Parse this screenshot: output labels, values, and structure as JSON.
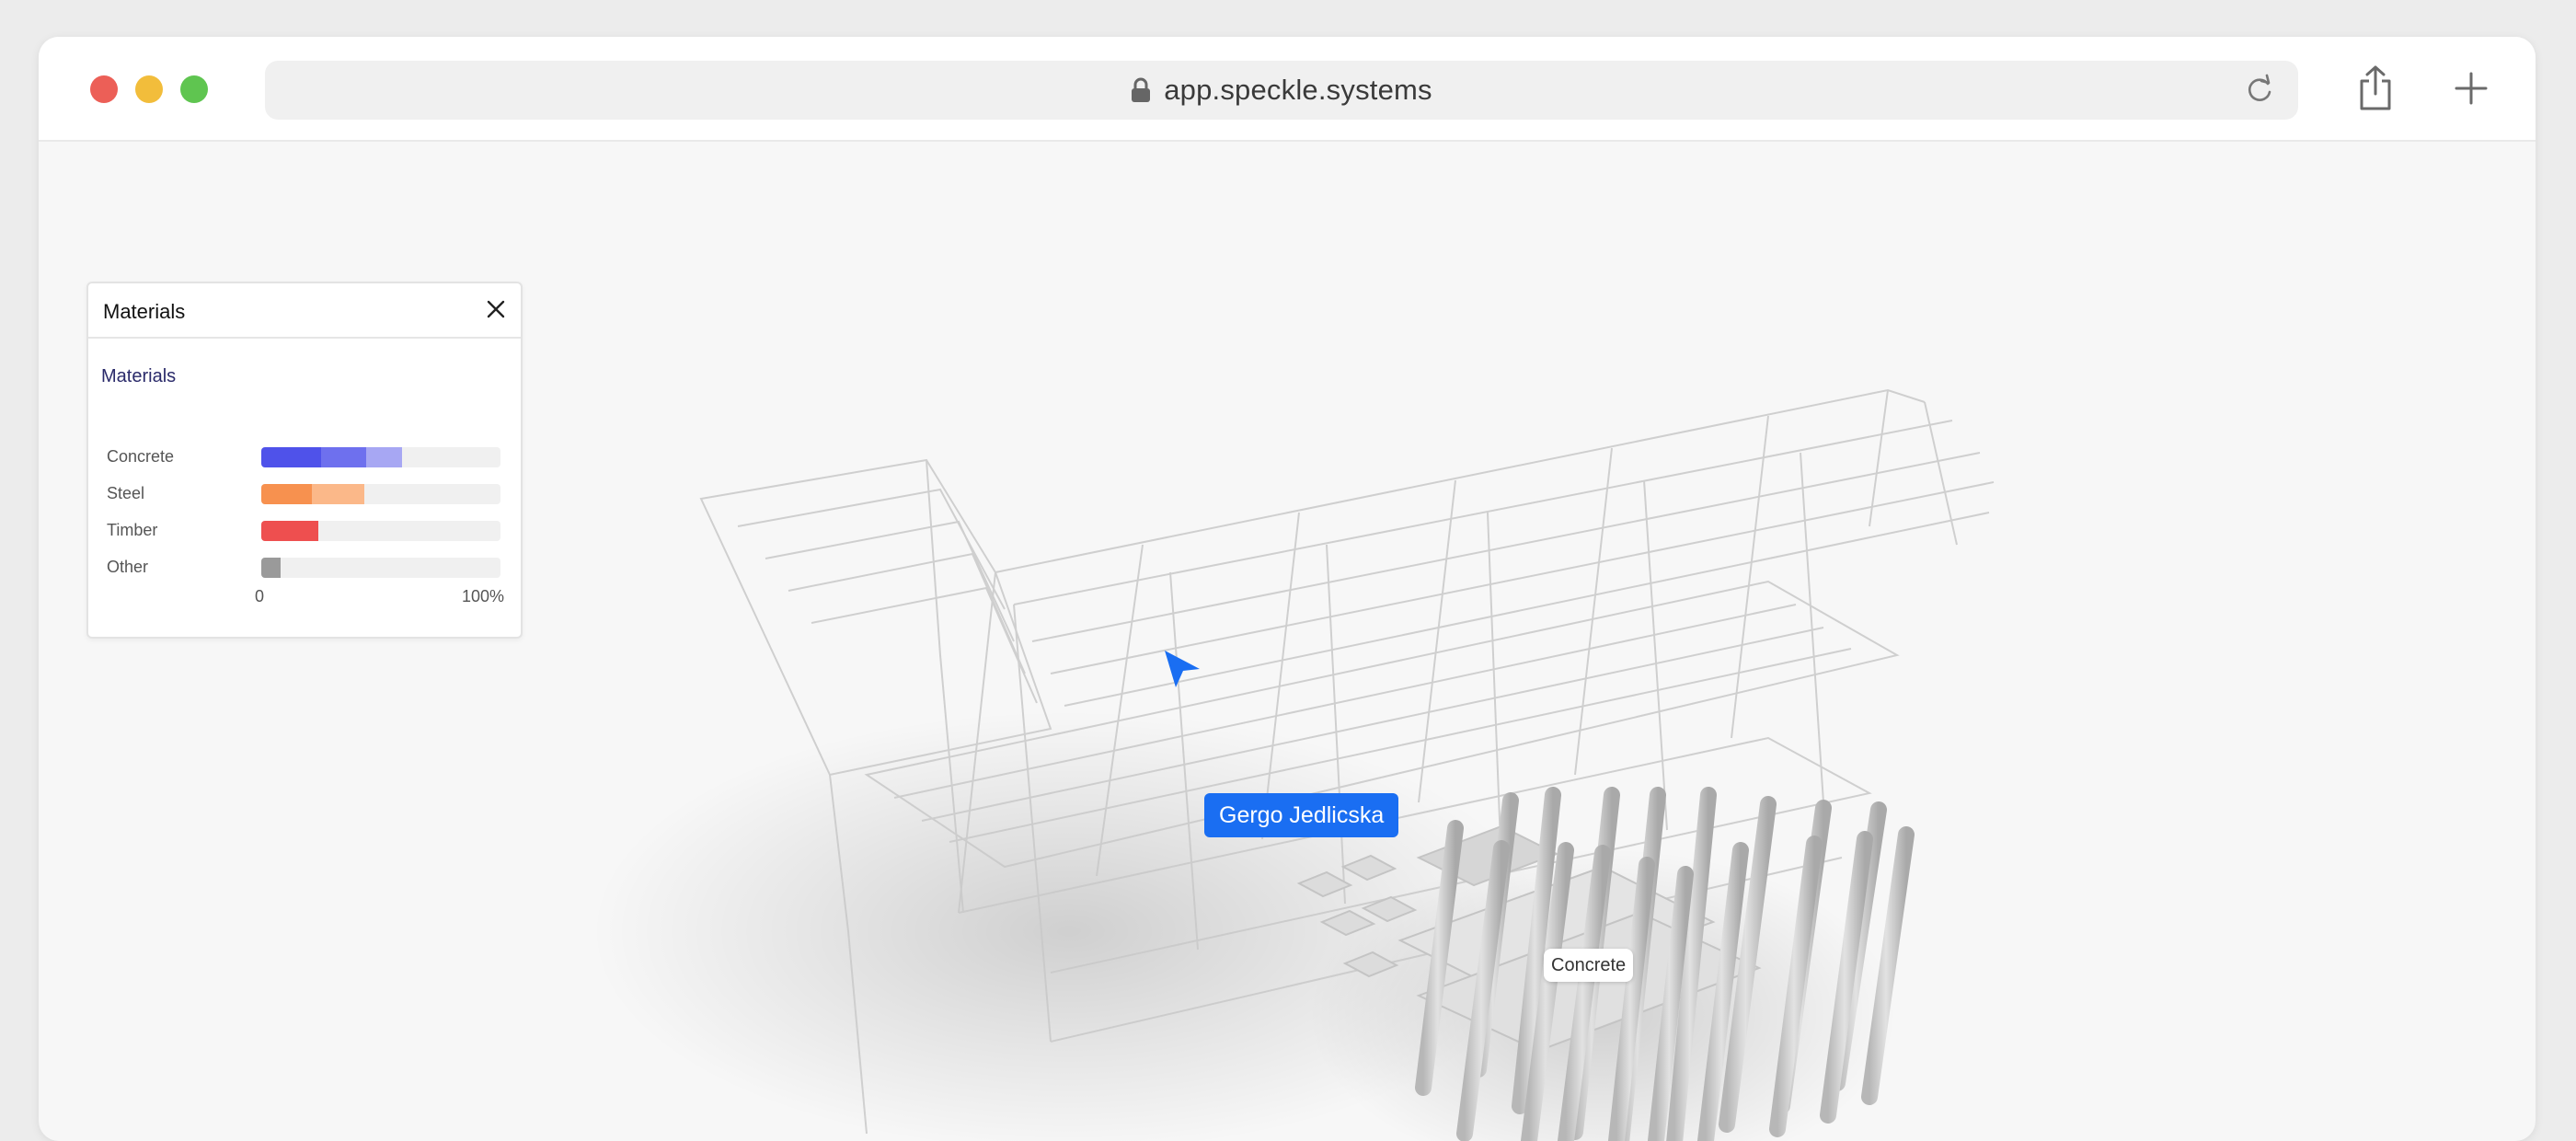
{
  "browser": {
    "url": "app.speckle.systems",
    "traffic_lights": {
      "close": "#ec5f57",
      "minimize": "#f2bd3b",
      "maximize": "#5fc550"
    }
  },
  "materials_panel": {
    "title": "Materials",
    "section_title": "Materials",
    "rows": [
      {
        "label": "Concrete",
        "segments": [
          {
            "pct": 0.25,
            "color": "#4f52ea"
          },
          {
            "pct": 0.19,
            "color": "#6e70ee"
          },
          {
            "pct": 0.15,
            "color": "#a7a7f3"
          }
        ]
      },
      {
        "label": "Steel",
        "segments": [
          {
            "pct": 0.21,
            "color": "#f7914f"
          },
          {
            "pct": 0.22,
            "color": "#fbb889"
          }
        ]
      },
      {
        "label": "Timber",
        "segments": [
          {
            "pct": 0.24,
            "color": "#ee4f4f"
          }
        ]
      },
      {
        "label": "Other",
        "segments": [
          {
            "pct": 0.08,
            "color": "#9a9a9a"
          }
        ]
      }
    ],
    "axis_min_label": "0",
    "axis_max_label": "100%"
  },
  "viewer": {
    "collaborator_name": "Gergo Jedlicska",
    "collaborator_color": "#1a6ef2",
    "object_label": "Concrete"
  }
}
